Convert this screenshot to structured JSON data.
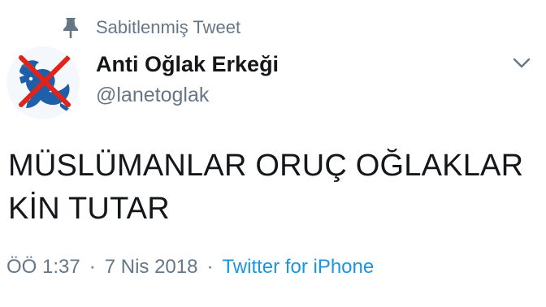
{
  "pinned": {
    "icon": "pin-icon",
    "label": "Sabitlenmiş Tweet"
  },
  "author": {
    "avatar_icon": "capricorn-crossed-out-avatar",
    "display_name": "Anti Oğlak Erkeği",
    "handle": "@lanetoglak"
  },
  "menu": {
    "icon": "chevron-down-icon"
  },
  "tweet": {
    "text": "MÜSLÜMANLAR ORUÇ OĞLAKLAR KİN TUTAR"
  },
  "meta": {
    "time": "ÖÖ 1:37",
    "date": "7 Nis 2018",
    "separator": "·",
    "source": "Twitter for iPhone"
  },
  "colors": {
    "text": "#14171a",
    "secondary": "#657786",
    "link": "#1b95e0",
    "avatar_symbol": "#1e5fa8",
    "avatar_cross": "#e2231a"
  }
}
